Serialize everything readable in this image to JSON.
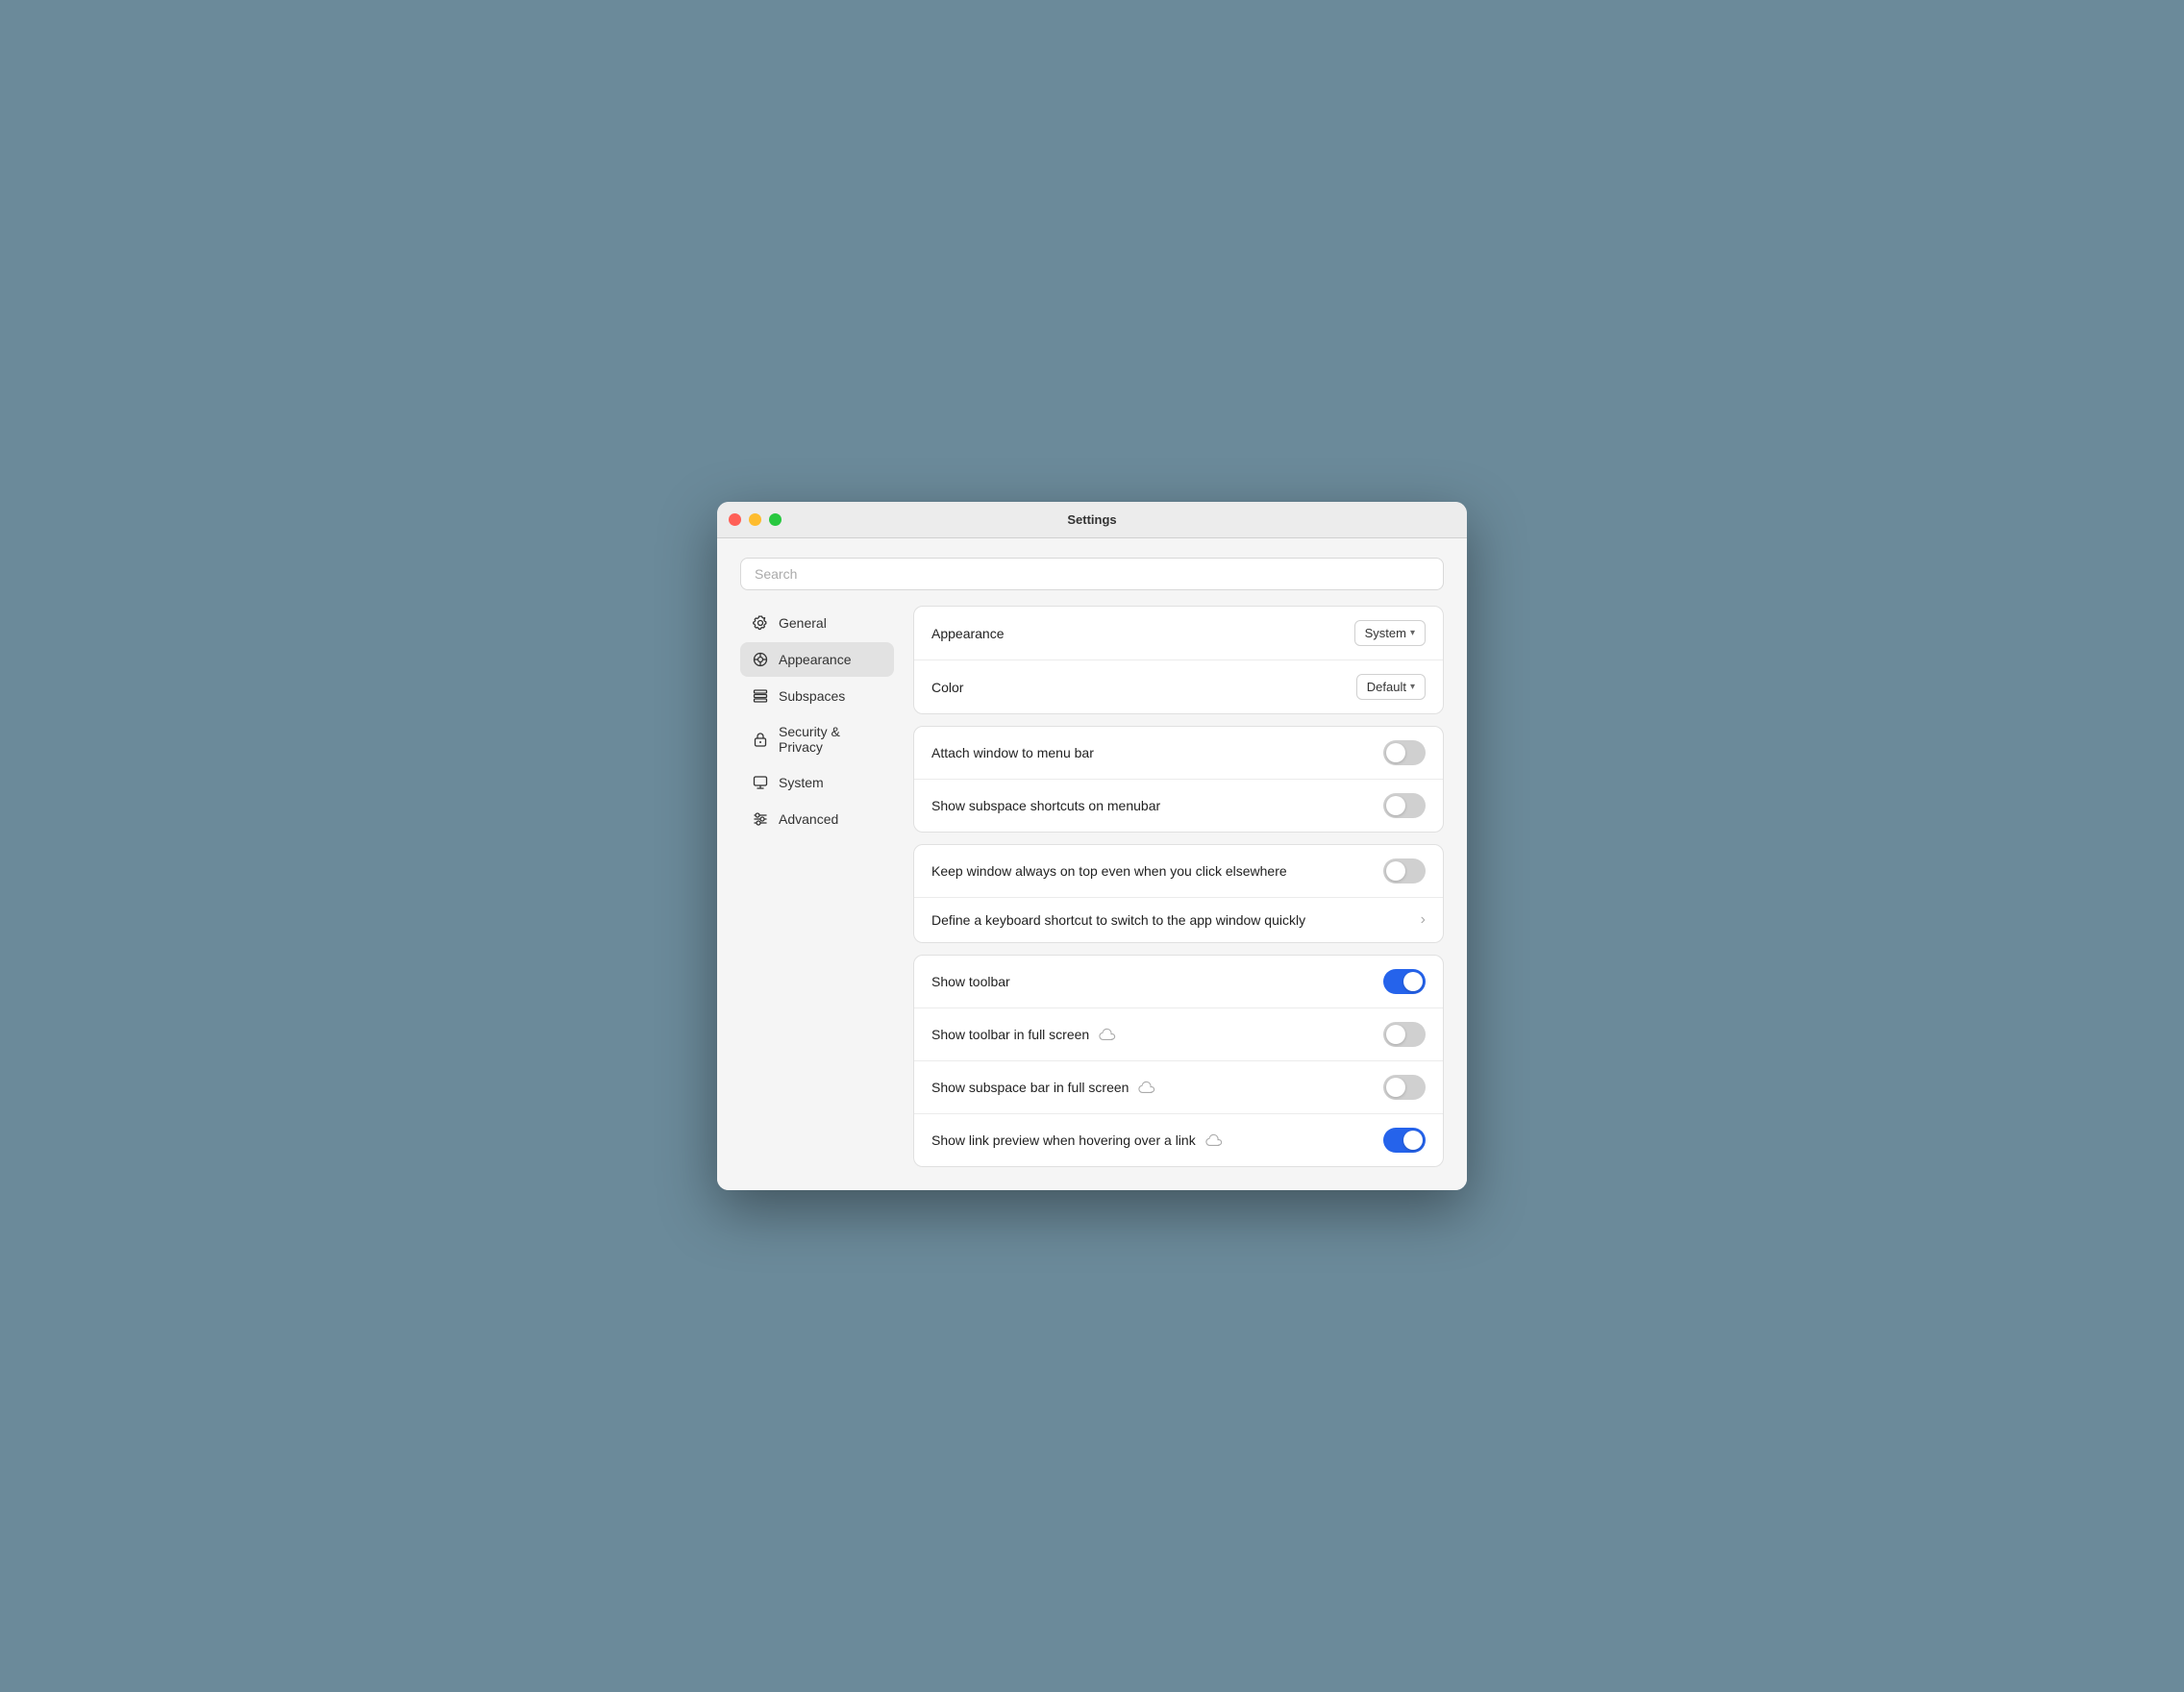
{
  "window": {
    "title": "Settings"
  },
  "search": {
    "placeholder": "Search"
  },
  "sidebar": {
    "items": [
      {
        "id": "general",
        "label": "General",
        "icon": "gear"
      },
      {
        "id": "appearance",
        "label": "Appearance",
        "icon": "appearance",
        "active": true
      },
      {
        "id": "subspaces",
        "label": "Subspaces",
        "icon": "subspaces"
      },
      {
        "id": "security",
        "label": "Security & Privacy",
        "icon": "lock"
      },
      {
        "id": "system",
        "label": "System",
        "icon": "monitor"
      },
      {
        "id": "advanced",
        "label": "Advanced",
        "icon": "sliders"
      }
    ]
  },
  "panels": [
    {
      "id": "appearance-panel",
      "rows": [
        {
          "id": "appearance-row",
          "label": "Appearance",
          "control": "dropdown",
          "value": "System"
        },
        {
          "id": "color-row",
          "label": "Color",
          "control": "dropdown",
          "value": "Default"
        }
      ]
    },
    {
      "id": "menubar-panel",
      "rows": [
        {
          "id": "attach-window",
          "label": "Attach window to menu bar",
          "control": "toggle",
          "on": false
        },
        {
          "id": "subspace-shortcuts",
          "label": "Show subspace shortcuts on menubar",
          "control": "toggle",
          "on": false
        }
      ]
    },
    {
      "id": "window-panel",
      "rows": [
        {
          "id": "always-on-top",
          "label": "Keep window always on top even when you click elsewhere",
          "control": "toggle",
          "on": false
        },
        {
          "id": "keyboard-shortcut",
          "label": "Define a keyboard shortcut to switch to the app window quickly",
          "control": "arrow"
        }
      ]
    },
    {
      "id": "toolbar-panel",
      "rows": [
        {
          "id": "show-toolbar",
          "label": "Show toolbar",
          "control": "toggle",
          "on": true
        },
        {
          "id": "toolbar-fullscreen",
          "label": "Show toolbar in full screen",
          "control": "toggle",
          "on": false,
          "cloud": true
        },
        {
          "id": "subspace-bar-fullscreen",
          "label": "Show subspace bar in full screen",
          "control": "toggle",
          "on": false,
          "cloud": true
        },
        {
          "id": "link-preview",
          "label": "Show link preview when hovering over a link",
          "control": "toggle",
          "on": true,
          "cloud": true
        }
      ]
    }
  ]
}
